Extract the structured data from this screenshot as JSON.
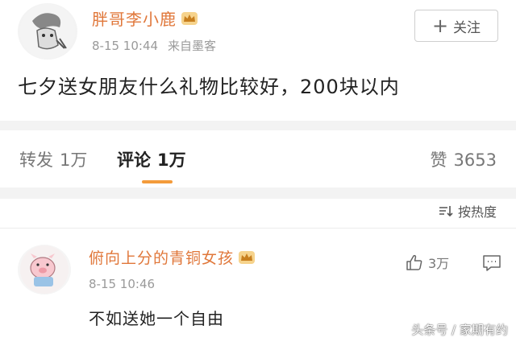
{
  "post": {
    "author": "胖哥李小鹿",
    "time": "8-15 10:44",
    "source": "来自墨客",
    "text": "七夕送女朋友什么礼物比较好，200块以内",
    "follow_label": "关注"
  },
  "actions": {
    "repost_label": "转发",
    "repost_count": "1万",
    "comment_label": "评论",
    "comment_count": "1万",
    "like_label": "赞",
    "like_count": "3653"
  },
  "sort_label": "按热度",
  "comment": {
    "author": "俯向上分的青铜女孩",
    "time": "8-15 10:46",
    "text": "不如送她一个自由",
    "like_count": "3万"
  },
  "watermark": "头条号 / 家期有约",
  "colors": {
    "author_name": "#e0773a",
    "crown_badge": "#e8a33a",
    "tab_underline": "#f39b3b"
  },
  "icons": [
    "crown-badge-icon",
    "plus-icon",
    "sort-icon",
    "thumbs-up-icon",
    "comment-reply-icon"
  ]
}
